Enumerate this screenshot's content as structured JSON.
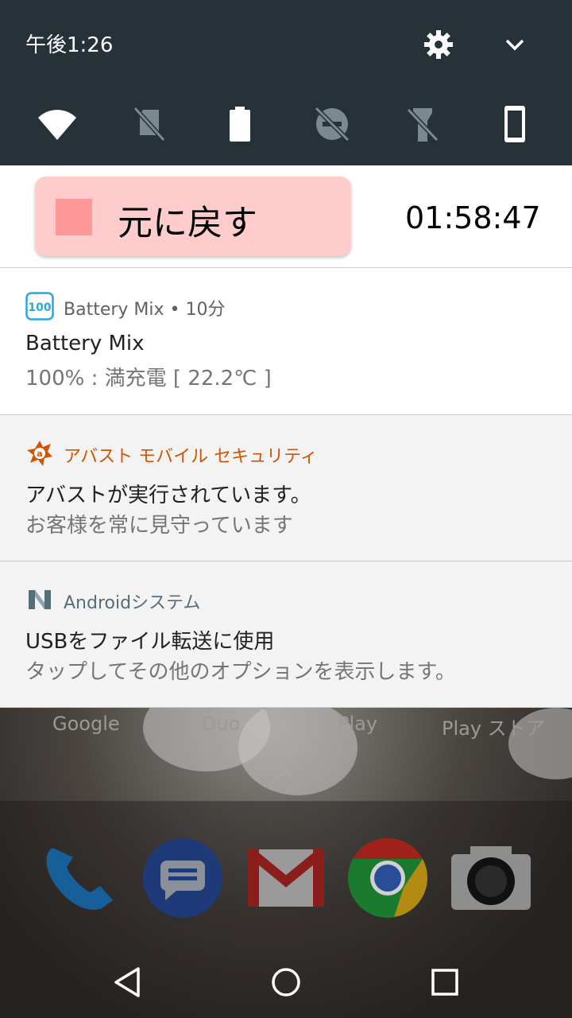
{
  "status_bar": {
    "time": "午後1:26",
    "settings_icon": "gear-icon",
    "expand_icon": "chevron-down-icon"
  },
  "quick_settings": [
    {
      "name": "wifi",
      "icon": "wifi-icon"
    },
    {
      "name": "no-sim",
      "icon": "no-sim-icon"
    },
    {
      "name": "battery",
      "icon": "battery-full-icon"
    },
    {
      "name": "do-not-disturb-off",
      "icon": "dnd-off-icon"
    },
    {
      "name": "flashlight-off",
      "icon": "flashlight-off-icon"
    },
    {
      "name": "portrait",
      "icon": "phone-portrait-icon"
    }
  ],
  "media": {
    "undo_label": "元に戻す",
    "timer": "01:58:47",
    "undo_color": "#ffcccc",
    "square_color": "#ff9999"
  },
  "notifications": [
    {
      "app": "Battery Mix • 10分",
      "title": "Battery Mix",
      "text": "100% : 満充電 [ 22.2℃ ]",
      "icon": "battery-100-icon",
      "app_color": "#616161"
    },
    {
      "app": "アバスト モバイル セキュリティ",
      "title": "アバストが実行されています。",
      "text": "お客様を常に見守っています",
      "icon": "avast-icon",
      "app_color": "#d35400"
    },
    {
      "app": "Androidシステム",
      "title": "USBをファイル転送に使用",
      "text": "タップしてその他のオプションを表示します。",
      "icon": "android-n-icon",
      "app_color": "#546e7a"
    }
  ],
  "home": {
    "app_labels": [
      "Google",
      "Duo",
      "Play",
      "Play ストア"
    ],
    "dock": [
      "phone-icon",
      "messages-icon",
      "gmail-icon",
      "chrome-icon",
      "camera-icon"
    ]
  },
  "nav": [
    "back-icon",
    "home-icon",
    "recents-icon"
  ]
}
